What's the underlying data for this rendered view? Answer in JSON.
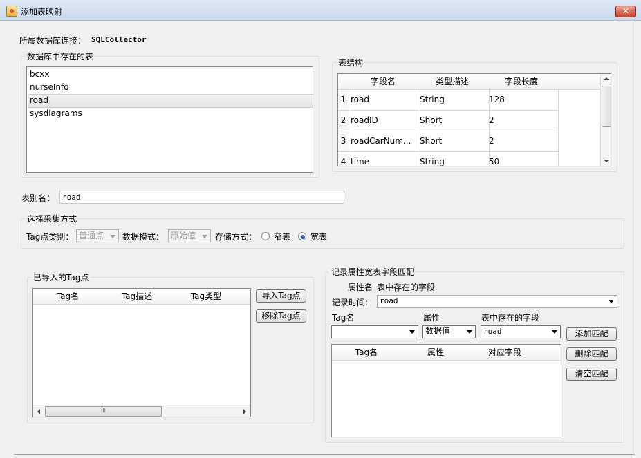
{
  "window": {
    "title": "添加表映射",
    "close": "✕"
  },
  "connection": {
    "label": "所属数据库连接：",
    "value": "SQLCollector"
  },
  "db_tables": {
    "title": "数据库中存在的表",
    "items": [
      "bcxx",
      "nurseInfo",
      "road",
      "sysdiagrams"
    ],
    "selected": "road"
  },
  "table_structure": {
    "title": "表结构",
    "columns": [
      "字段名",
      "类型描述",
      "字段长度"
    ],
    "rows": [
      {
        "num": "1",
        "name": "road",
        "type": "String",
        "length": "128"
      },
      {
        "num": "2",
        "name": "roadID",
        "type": "Short",
        "length": "2"
      },
      {
        "num": "3",
        "name": "roadCarNum...",
        "type": "Short",
        "length": "2"
      },
      {
        "num": "4",
        "name": "time",
        "type": "String",
        "length": "50"
      }
    ]
  },
  "alias": {
    "label": "表别名：",
    "value": "road"
  },
  "collect_mode": {
    "title": "选择采集方式",
    "tag_type_label": "Tag点类别：",
    "tag_type_value": "普通点",
    "data_mode_label": "数据模式：",
    "data_mode_value": "原始值",
    "storage_label": "存储方式：",
    "narrow_label": "窄表",
    "wide_label": "宽表",
    "selected": "宽表"
  },
  "imported_tags": {
    "title": "已导入的Tag点",
    "columns": [
      "Tag名",
      "Tag描述",
      "Tag类型"
    ],
    "import_button": "导入Tag点",
    "remove_button": "移除Tag点",
    "scroll_grip": "III"
  },
  "wide_match": {
    "title": "记录属性宽表字段匹配",
    "subheader_attr": "属性名",
    "subheader_field": "表中存在的字段",
    "record_time_label": "记录时间:",
    "record_time_value": "road",
    "tag_label": "Tag名",
    "attr_label": "属性",
    "field_label": "表中存在的字段",
    "tag_value": "",
    "attr_value": "数据值",
    "field_value": "road",
    "columns": [
      "Tag名",
      "属性",
      "对应字段"
    ],
    "add_button": "添加匹配",
    "delete_button": "删除匹配",
    "clear_button": "清空匹配"
  },
  "colors": {
    "selection": "#e4e4e4",
    "accent": "#2c5fb0",
    "close": "#c7442e"
  }
}
